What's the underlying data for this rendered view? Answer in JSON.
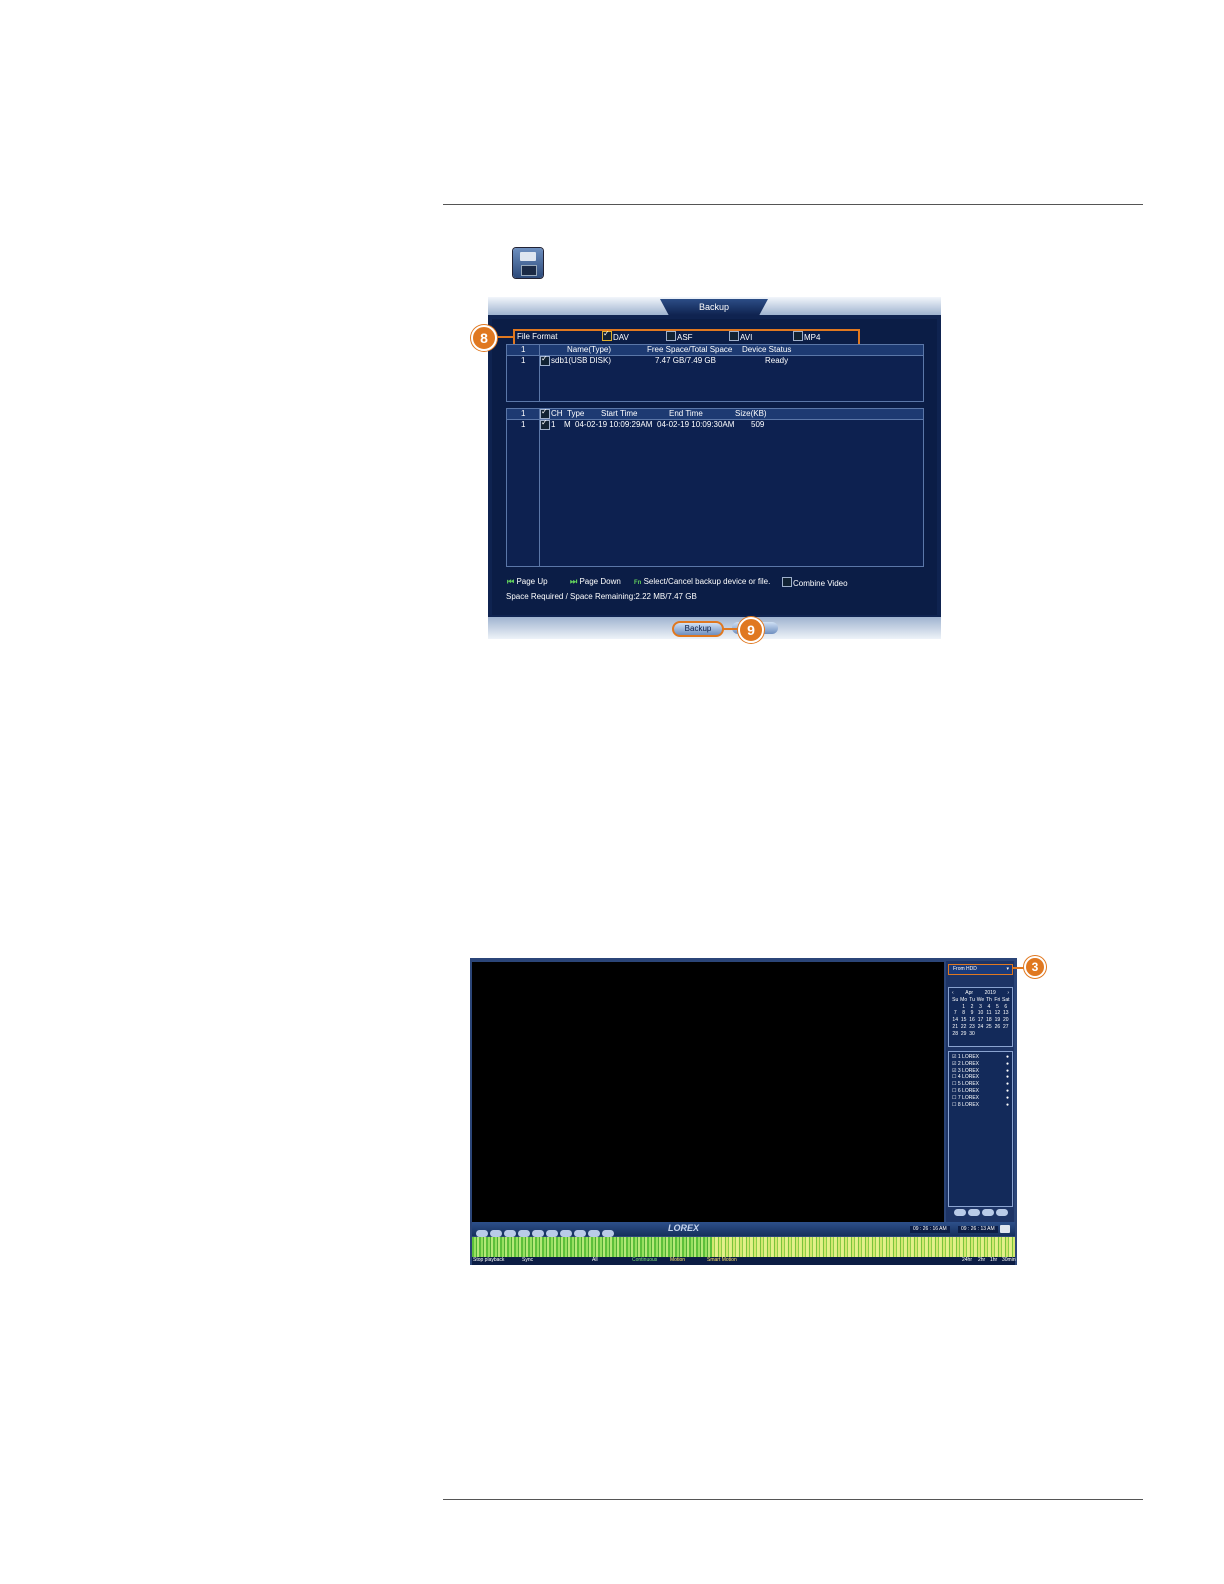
{
  "floppy_icon": "floppy-disk-icon",
  "backup_dialog": {
    "title": "Backup",
    "file_format": {
      "label": "File Format",
      "options": [
        {
          "label": "DAV",
          "checked": true
        },
        {
          "label": "ASF",
          "checked": false
        },
        {
          "label": "AVI",
          "checked": false
        },
        {
          "label": "MP4",
          "checked": false
        }
      ]
    },
    "device_table": {
      "headers": [
        "1",
        "Name(Type)",
        "Free Space/Total Space",
        "Device Status"
      ],
      "rows": [
        {
          "index": "1",
          "name": "sdb1(USB DISK)",
          "space": "7.47 GB/7.49 GB",
          "status": "Ready"
        }
      ]
    },
    "file_table": {
      "headers": [
        "1",
        "CH",
        "Type",
        "Start Time",
        "End Time",
        "Size(KB)"
      ],
      "rows": [
        {
          "index": "1",
          "ch": "1",
          "type": "M",
          "start": "04-02-19 10:09:29AM",
          "end": "04-02-19 10:09:30AM",
          "size": "509"
        }
      ]
    },
    "legend": {
      "page_up": "Page Up",
      "page_down": "Page Down",
      "fn_icon": "Fn",
      "select_cancel": "Select/Cancel backup device or file.",
      "combine_video": "Combine Video"
    },
    "space_line": "Space Required / Space Remaining:2.22 MB/7.47 GB",
    "backup_button": "Backup"
  },
  "callouts": {
    "c8": "8",
    "c9": "9",
    "c3": "3"
  },
  "playback": {
    "source_select": "From HDD",
    "calendar": {
      "month": "Apr",
      "year": "2019",
      "weekdays": [
        "Su",
        "Mo",
        "Tu",
        "We",
        "Th",
        "Fri",
        "Sat"
      ],
      "weeks": [
        [
          "",
          "1",
          "2",
          "3",
          "4",
          "5",
          "6"
        ],
        [
          "7",
          "8",
          "9",
          "10",
          "11",
          "12",
          "13"
        ],
        [
          "14",
          "15",
          "16",
          "17",
          "18",
          "19",
          "20"
        ],
        [
          "21",
          "22",
          "23",
          "24",
          "25",
          "26",
          "27"
        ],
        [
          "28",
          "29",
          "30",
          "",
          "",
          "",
          ""
        ]
      ]
    },
    "channels": [
      {
        "label": "1 LOREX",
        "checked": true
      },
      {
        "label": "2 LOREX",
        "checked": true
      },
      {
        "label": "3 LOREX",
        "checked": true
      },
      {
        "label": "4 LOREX",
        "checked": false
      },
      {
        "label": "5 LOREX",
        "checked": false
      },
      {
        "label": "6 LOREX",
        "checked": false
      },
      {
        "label": "7 LOREX",
        "checked": false
      },
      {
        "label": "8 LOREX",
        "checked": false
      }
    ],
    "brand": "LOREX",
    "time_left": "09 : 26 : 16 AM",
    "time_right": "09 : 26 : 13 AM",
    "status_items": [
      "Stop playback",
      "Sync",
      "All",
      "Continuous",
      "Motion",
      "Smart Motion"
    ],
    "zoom_items": [
      "24hr",
      "2hr",
      "1hr",
      "30min"
    ]
  }
}
